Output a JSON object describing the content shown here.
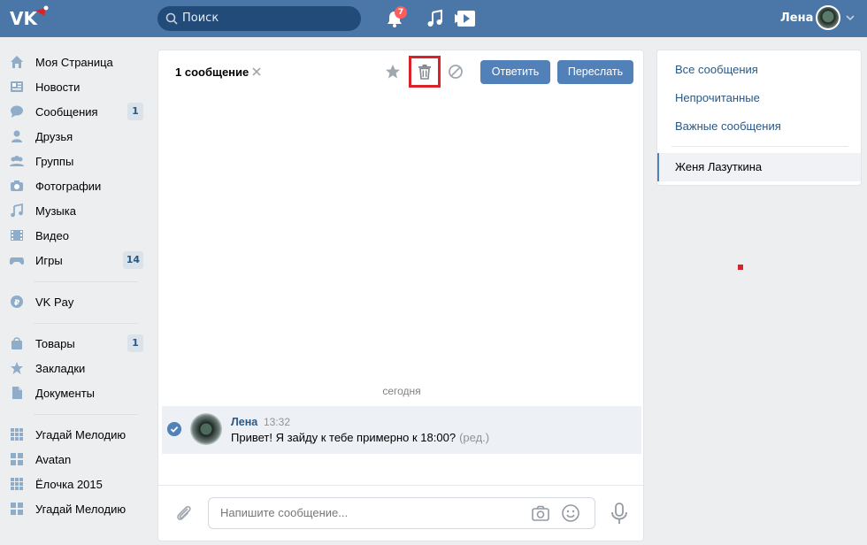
{
  "header": {
    "search_placeholder": "Поиск",
    "notification_count": "7",
    "user_name": "Лена",
    "brand_color": "#4a76a8"
  },
  "nav": {
    "items": [
      {
        "label": "Моя Страница",
        "icon": "home-icon"
      },
      {
        "label": "Новости",
        "icon": "news-icon"
      },
      {
        "label": "Сообщения",
        "icon": "messages-icon",
        "count": "1"
      },
      {
        "label": "Друзья",
        "icon": "friends-icon"
      },
      {
        "label": "Группы",
        "icon": "groups-icon"
      },
      {
        "label": "Фотографии",
        "icon": "camera-icon"
      },
      {
        "label": "Музыка",
        "icon": "music-icon"
      },
      {
        "label": "Видео",
        "icon": "video-icon"
      },
      {
        "label": "Игры",
        "icon": "games-icon",
        "count": "14"
      },
      {
        "label": "VK Pay",
        "icon": "vkpay-icon"
      },
      {
        "label": "Товары",
        "icon": "bag-icon",
        "count": "1"
      },
      {
        "label": "Закладки",
        "icon": "star-icon"
      },
      {
        "label": "Документы",
        "icon": "document-icon"
      },
      {
        "label": "Угадай Мелодию",
        "icon": "app-icon"
      },
      {
        "label": "Avatan",
        "icon": "app-icon"
      },
      {
        "label": "Ёлочка 2015",
        "icon": "app-icon"
      },
      {
        "label": "Угадай Мелодию",
        "icon": "app-icon"
      }
    ]
  },
  "dialog": {
    "selection_label": "1 сообщение",
    "reply_button": "Ответить",
    "forward_button": "Переслать",
    "date_separator": "сегодня",
    "message": {
      "author": "Лена",
      "time": "13:32",
      "text": "Привет! Я зайду к тебе примерно к 18:00?",
      "edited": "(ред.)"
    },
    "composer_placeholder": "Напишите сообщение..."
  },
  "right_panel": {
    "items": [
      "Все сообщения",
      "Непрочитанные",
      "Важные сообщения"
    ],
    "active_chat": "Женя Лазуткина"
  }
}
